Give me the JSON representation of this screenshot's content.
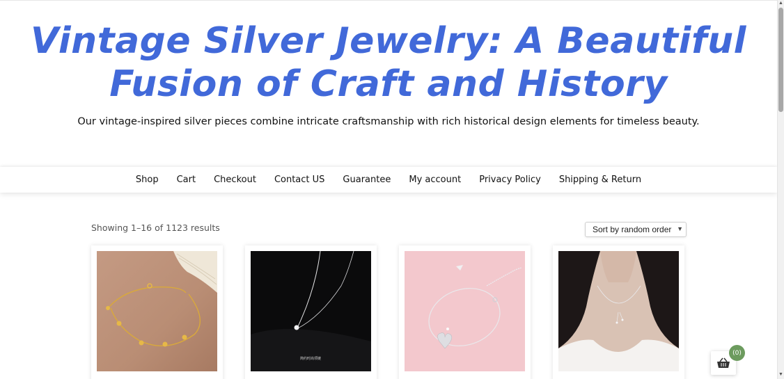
{
  "site": {
    "title_line1": "Vintage Silver Jewelry: A Beautiful",
    "title_line2": "Fusion of Craft and History",
    "tagline": "Our vintage-inspired silver pieces combine intricate craftsmanship with rich historical design elements for timeless beauty."
  },
  "nav": {
    "items": [
      {
        "label": "Shop"
      },
      {
        "label": "Cart"
      },
      {
        "label": "Checkout"
      },
      {
        "label": "Contact US"
      },
      {
        "label": "Guarantee"
      },
      {
        "label": "My account"
      },
      {
        "label": "Privacy Policy"
      },
      {
        "label": "Shipping & Return"
      }
    ]
  },
  "shop": {
    "result_count": "Showing 1–16 of 1123 results",
    "sort_selected": "Sort by random order"
  },
  "products": [
    {
      "image": "gold-chain-anklet-photo"
    },
    {
      "image": "silver-necklace-black-bg-photo",
      "caption_text": "简约时尚项链"
    },
    {
      "image": "silver-heart-bracelet-pink-photo"
    },
    {
      "image": "model-wearing-silver-necklace-photo"
    }
  ],
  "cart": {
    "count_label": "(0)",
    "icon": "basket-icon"
  },
  "colors": {
    "title": "#4169d9",
    "cart_badge": "#6c9b5e"
  }
}
